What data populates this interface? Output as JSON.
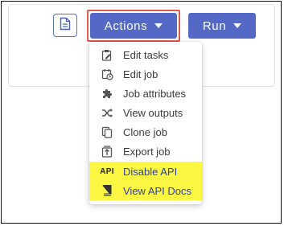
{
  "toolbar": {
    "document_icon": "document-icon",
    "actions_label": "Actions",
    "run_label": "Run",
    "highlight_color": "#e05a4e",
    "button_color": "#5468c5"
  },
  "actions_menu": {
    "items": [
      {
        "label": "Edit tasks",
        "icon": "clipboard-edit-icon"
      },
      {
        "label": "Edit job",
        "icon": "calendar-clock-icon"
      },
      {
        "label": "Job attributes",
        "icon": "puzzle-icon"
      },
      {
        "label": "View outputs",
        "icon": "shuffle-icon"
      },
      {
        "label": "Clone job",
        "icon": "copy-icon"
      },
      {
        "label": "Export job",
        "icon": "export-icon"
      },
      {
        "label": "Disable API",
        "icon": "api-tag",
        "icon_text": "API",
        "highlighted": true
      },
      {
        "label": "View API Docs",
        "icon": "book-icon",
        "highlighted": true
      }
    ],
    "highlight_color": "#fbf742"
  }
}
